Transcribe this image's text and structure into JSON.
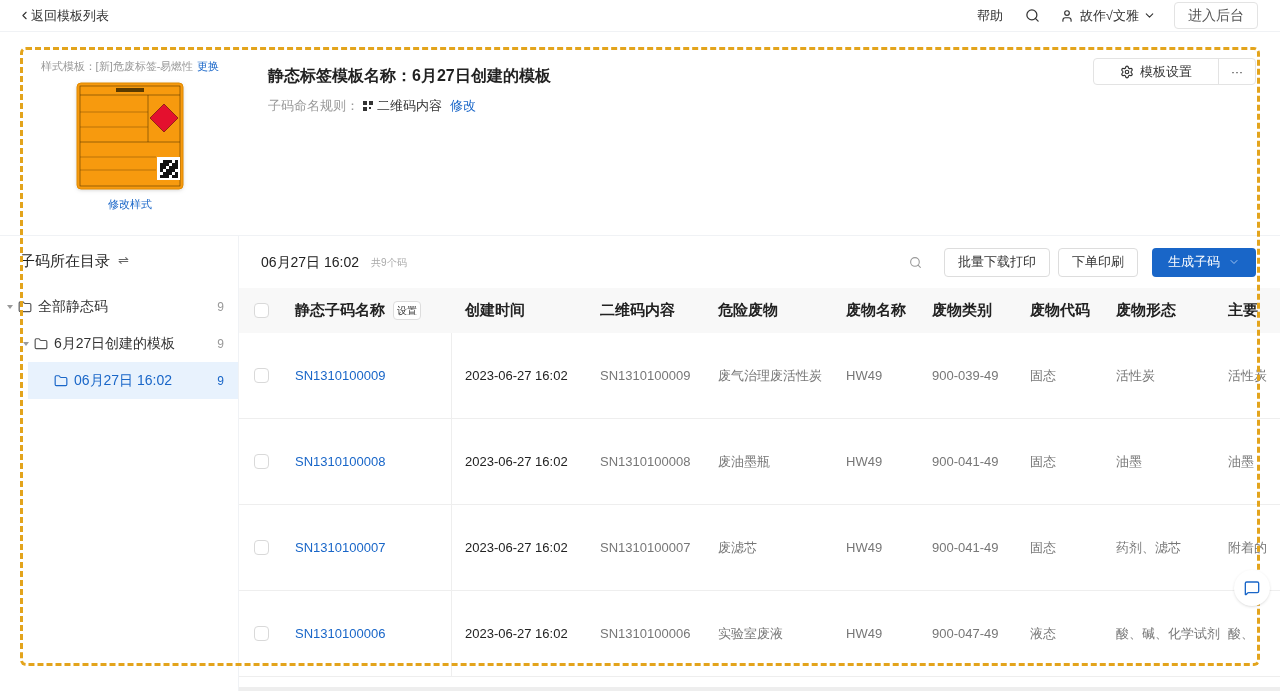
{
  "top_bar": {
    "back_link": "返回模板列表",
    "help": "帮助",
    "user_name": "故作√文雅",
    "admin_button": "进入后台"
  },
  "template": {
    "style_label": "样式模板：",
    "style_name": "[新]危废标签-易燃性",
    "change_link": "更换",
    "edit_style_link": "修改样式",
    "title": "静态标签模板名称：6月27日创建的模板",
    "naming_rule_label": "子码命名规则：",
    "naming_rule_value": "二维码内容",
    "naming_rule_edit": "修改",
    "settings_button": "模板设置",
    "more_button": "···"
  },
  "sidebar": {
    "title": "子码所在目录",
    "swap_icon": "⇌",
    "tree": [
      {
        "label": "全部静态码",
        "count": "9",
        "expanded": true,
        "selected": false,
        "children": [
          {
            "label": "6月27日创建的模板",
            "count": "9",
            "expanded": true,
            "selected": false,
            "children": [
              {
                "label": "06月27日 16:02",
                "count": "9",
                "selected": true
              }
            ]
          }
        ]
      }
    ]
  },
  "toolbar": {
    "title": "06月27日 16:02",
    "count": "共9个码",
    "buttons": [
      {
        "label": "批量下载打印",
        "kind": "default"
      },
      {
        "label": "下单印刷",
        "kind": "default"
      },
      {
        "label": "生成子码",
        "kind": "primary"
      }
    ]
  },
  "table": {
    "header_checked": false,
    "name_setting": "设置",
    "columns": [
      "静态子码名称",
      "创建时间",
      "二维码内容",
      "危险废物",
      "废物名称",
      "废物类别",
      "废物代码",
      "废物形态",
      "主要"
    ],
    "rows": [
      {
        "checked": false,
        "cells": [
          "SN1310100009",
          "2023-06-27 16:02",
          "SN1310100009",
          "废气治理废活性炭",
          "HW49",
          "900-039-49",
          "固态",
          "活性炭",
          "活性炭"
        ]
      },
      {
        "checked": false,
        "cells": [
          "SN1310100008",
          "2023-06-27 16:02",
          "SN1310100008",
          "废油墨瓶",
          "HW49",
          "900-041-49",
          "固态",
          "油墨",
          "油墨"
        ]
      },
      {
        "checked": false,
        "cells": [
          "SN1310100007",
          "2023-06-27 16:02",
          "SN1310100007",
          "废滤芯",
          "HW49",
          "900-041-49",
          "固态",
          "药剂、滤芯",
          "附着的"
        ]
      },
      {
        "checked": false,
        "cells": [
          "SN1310100006",
          "2023-06-27 16:02",
          "SN1310100006",
          "实验室废液",
          "HW49",
          "900-047-49",
          "液态",
          "酸、碱、化学试剂",
          "酸、"
        ]
      }
    ]
  }
}
